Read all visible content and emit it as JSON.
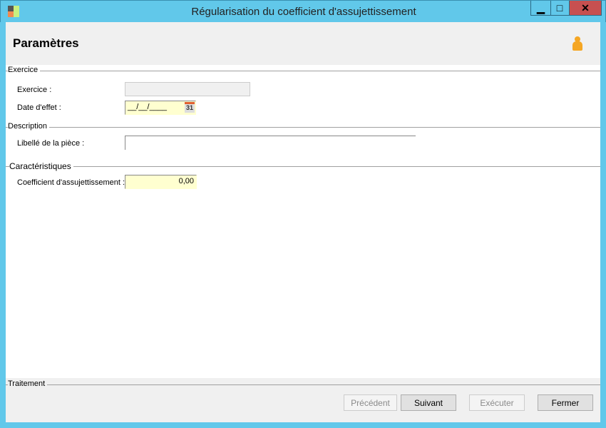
{
  "window": {
    "title": "Régularisation du coefficient d'assujettissement",
    "minimize": "▁",
    "maximize": "□",
    "close": "✕"
  },
  "header": {
    "title": "Paramètres",
    "icon": "user-icon"
  },
  "sections": {
    "exercice": {
      "title": "Exercice",
      "exercice_label": "Exercice :",
      "exercice_value": "",
      "date_label": "Date d'effet :",
      "date_value": "__/__/____",
      "calendar_text": "31"
    },
    "description": {
      "title": "Description",
      "libelle_label": "Libellé de la pièce :",
      "libelle_value": ""
    },
    "caracteristiques": {
      "title": "Caractéristiques",
      "coef_label": "Coefficient d'assujettissement :",
      "coef_value": "0,00"
    },
    "traitement": {
      "title": "Traitement"
    }
  },
  "buttons": {
    "previous": "Précédent",
    "next": "Suivant",
    "execute": "Exécuter",
    "close": "Fermer"
  },
  "colors": {
    "frame": "#61c8ea",
    "close": "#c75050",
    "required": "#ffffd0"
  }
}
